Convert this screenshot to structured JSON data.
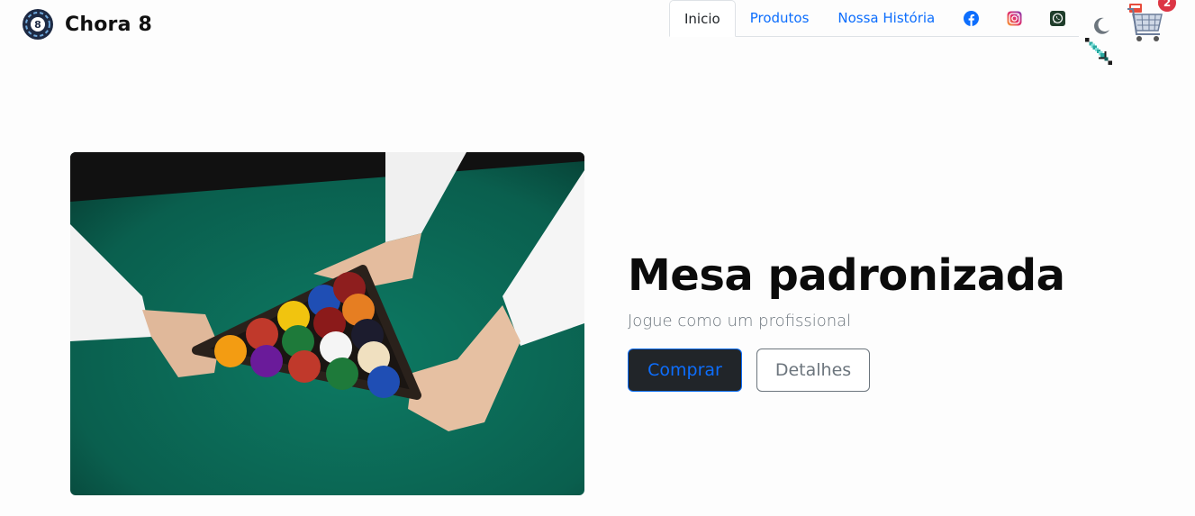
{
  "brand": {
    "name": "Chora 8"
  },
  "nav": {
    "tabs": [
      {
        "label": "Inicio",
        "active": true
      },
      {
        "label": "Produtos",
        "active": false
      },
      {
        "label": "Nossa História",
        "active": false
      }
    ],
    "social": [
      "facebook-icon",
      "instagram-icon",
      "whatsapp-icon"
    ]
  },
  "theme_toggle": {
    "icon": "moon-icon"
  },
  "cart": {
    "count": "2",
    "icon": "shopping-cart-icon"
  },
  "hero": {
    "title": "Mesa padronizada",
    "subtitle": "Jogue como um profissional",
    "buy_label": "Comprar",
    "details_label": "Detalhes"
  },
  "colors": {
    "link": "#0d6efd",
    "buy_bg": "#212529",
    "badge": "#dc3545",
    "felt": "#0b6b58"
  }
}
